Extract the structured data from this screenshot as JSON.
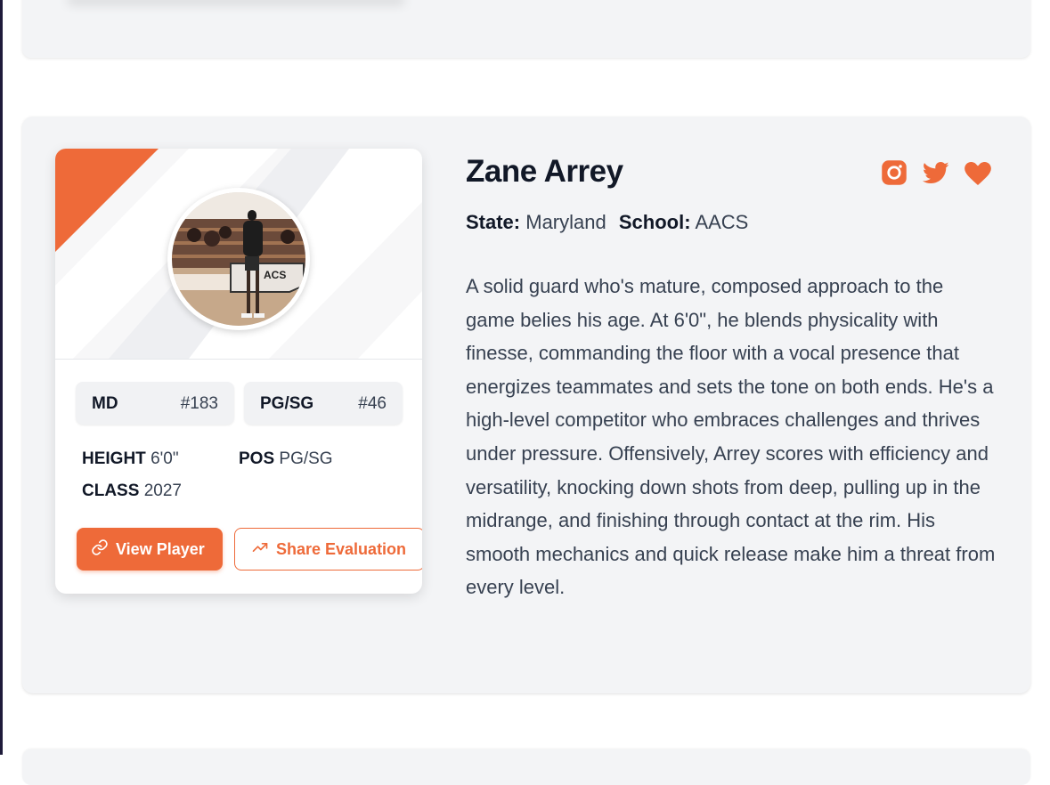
{
  "player": {
    "name": "Zane Arrey",
    "state_label": "State:",
    "state": "Maryland",
    "school_label": "School:",
    "school": "AACS",
    "bio": "A solid guard who's mature, composed approach to the game belies his age. At 6'0\", he blends physicality with finesse, commanding the floor with a vocal presence that energizes teammates and sets the tone on both ends. He's a high-level competitor who embraces challenges and thrives under pressure. Offensively, Arrey scores with efficiency and versatility, knocking down shots from deep, pulling up in the midrange, and finishing through contact at the rim. His smooth mechanics and quick release make him a threat from every level."
  },
  "rankings": [
    {
      "label": "MD",
      "rank": "#183"
    },
    {
      "label": "PG/SG",
      "rank": "#46"
    }
  ],
  "stats": {
    "height_label": "HEIGHT",
    "height": "6'0\"",
    "pos_label": "POS",
    "pos": "PG/SG",
    "class_label": "CLASS",
    "class": "2027"
  },
  "buttons": {
    "view_player": "View Player",
    "share_evaluation": "Share Evaluation"
  },
  "photo": {
    "banner_lettering": "ACS"
  },
  "icons": {
    "view_player": "link-icon",
    "share_evaluation": "trending-up-icon",
    "social": [
      "instagram-icon",
      "twitter-icon",
      "heart-icon"
    ]
  },
  "colors": {
    "accent": "#ee6a39",
    "card_bg": "#f3f4f6",
    "text_dark": "#111827",
    "text_body": "#374151"
  }
}
